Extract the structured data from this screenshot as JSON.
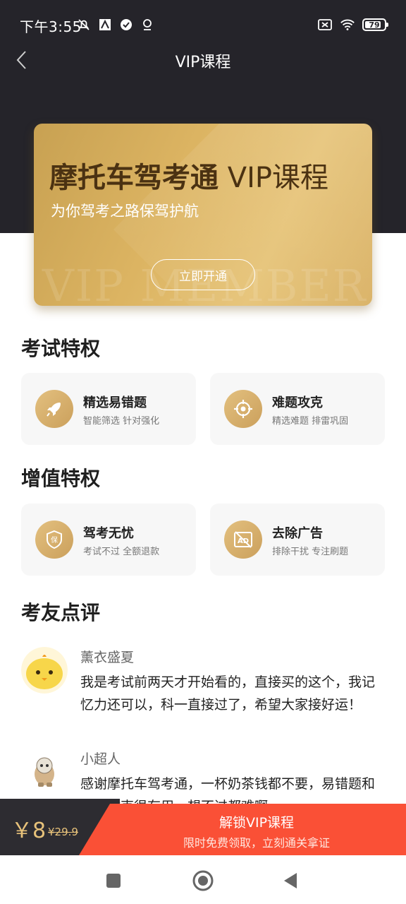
{
  "status_bar": {
    "time": "下午3:55",
    "battery_level": "79",
    "icons_left": [
      "mute-icon",
      "app-notification-icon",
      "check-badge-icon",
      "location-pin-icon"
    ],
    "icons_right": [
      "sim-icon",
      "wifi-icon",
      "battery-icon"
    ]
  },
  "nav": {
    "title": "VIP课程",
    "back_icon": "chevron-left-icon"
  },
  "vip_card": {
    "title_bold": "摩托车驾考通",
    "title_light": "VIP课程",
    "subtitle": "为你驾考之路保驾护航",
    "button_label": "立即开通",
    "watermark": "VIP MEMBER"
  },
  "exam_privileges": {
    "title": "考试特权",
    "items": [
      {
        "name": "精选易错题",
        "desc": "智能筛选 针对强化",
        "icon": "rocket-icon"
      },
      {
        "name": "难题攻克",
        "desc": "精选难题 排雷巩固",
        "icon": "target-icon"
      }
    ]
  },
  "value_privileges": {
    "title": "增值特权",
    "items": [
      {
        "name": "驾考无忧",
        "desc": "考试不过 全额退款",
        "icon": "shield-icon"
      },
      {
        "name": "去除广告",
        "desc": "排除干扰 专注刷题",
        "icon": "no-ads-icon"
      }
    ]
  },
  "reviews": {
    "title": "考友点评",
    "items": [
      {
        "name": "薰衣盛夏",
        "text": "我是考试前两天才开始看的，直接买的这个，我记忆力还可以，科一直接过了，希望大家接好运！"
      },
      {
        "name": "小超人",
        "text": "感谢摩托车驾考通，一杯奶茶钱都不要，易错题和难题攻克很有用，想不过都难啊"
      }
    ]
  },
  "purchase": {
    "currency": "￥",
    "price": "8",
    "original_price": "¥29.9",
    "cta_title": "解锁VIP课程",
    "cta_subtitle": "限时免费领取，立刻通关拿证"
  },
  "colors": {
    "header_bg": "#25242a",
    "gold": "#dcb462",
    "cta_red": "#fa5036"
  }
}
